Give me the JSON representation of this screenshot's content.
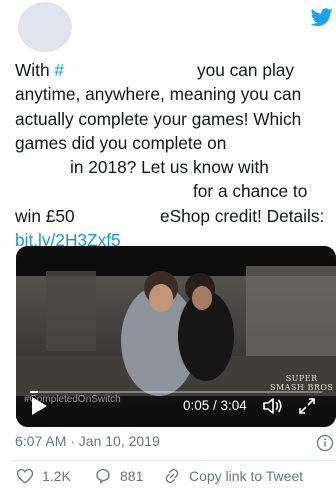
{
  "tweet": {
    "text_lines": [
      {
        "a": "With ",
        "hash": "#",
        "b": "you can play"
      },
      {
        "t": "anytime, anywhere, meaning you can"
      },
      {
        "t": "actually complete your games! Which"
      },
      {
        "t": "games did you complete on"
      },
      {
        "t": "in 2018? Let us know with"
      },
      {
        "t": "for a chance to"
      },
      {
        "a": "win £50",
        "b": "eShop credit! Details:"
      }
    ],
    "link": "bit.ly/2H3Zxf5",
    "timestamp": "6:07 AM · Jan 10, 2019"
  },
  "video": {
    "overlay_hashtag": "#CompletedOnSwitch",
    "time": "0:05 / 3:04",
    "progress_fraction": 0.027,
    "logo_lines": [
      "SUPER",
      "SMASH BROS"
    ]
  },
  "actions": {
    "likes": "1.2K",
    "replies": "881",
    "copy_link": "Copy link to Tweet"
  },
  "colors": {
    "accent": "#1b95e0",
    "secondary_text": "#657786",
    "primary_text": "#14171a"
  },
  "icons": [
    "twitter-bird-icon",
    "play-icon",
    "volume-icon",
    "fullscreen-icon",
    "info-icon",
    "heart-icon",
    "reply-icon",
    "link-icon"
  ]
}
